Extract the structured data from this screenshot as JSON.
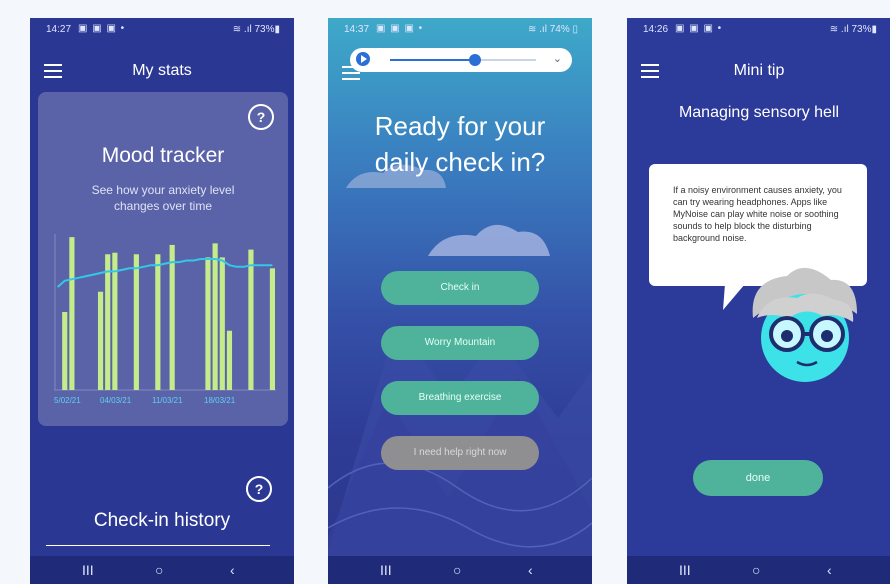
{
  "panel1": {
    "status": {
      "time": "14:27",
      "icons": "▣ ▣ ▣ •",
      "battery": "≋ .ıl 73%▮"
    },
    "title": "My stats",
    "mood": {
      "title": "Mood tracker",
      "subtitle": "See how your anxiety level changes over time",
      "help": "?"
    },
    "history": {
      "title": "Check-in history",
      "help": "?"
    }
  },
  "panel2": {
    "status": {
      "time": "14:37",
      "icons": "▣ ▣ ▣ •",
      "battery": "≋ .ıl 74% ▯"
    },
    "media": {
      "progress": 0.58
    },
    "title_line1": "Ready for your",
    "title_line2": "daily check in?",
    "buttons": {
      "check_in": "Check in",
      "worry": "Worry Mountain",
      "breathing": "Breathing exercise",
      "help": "I need help right now"
    }
  },
  "panel3": {
    "status": {
      "time": "14:26",
      "icons": "▣ ▣ ▣ •",
      "battery": "≋ .ıl 73%▮"
    },
    "title": "Mini tip",
    "subtitle": "Managing sensory hell",
    "tip": "If a noisy environment causes anxiety, you can try wearing headphones. Apps like MyNoise can play white noise or soothing sounds to help block the disturbing background noise.",
    "done": "done"
  },
  "nav": {
    "recent": "III",
    "home": "○",
    "back": "‹"
  },
  "colors": {
    "panel_bg": "#2b3893",
    "pill": "#4fb39b",
    "bar": "#c5ec8b",
    "line": "#33c8e8"
  },
  "chart_data": {
    "type": "bar",
    "x_tick_labels": [
      "5/02/21",
      "04/03/21",
      "11/03/21",
      "18/03/21"
    ],
    "bars": [
      0,
      0.5,
      0.98,
      0,
      0,
      0,
      0.63,
      0.87,
      0.88,
      0,
      0,
      0.87,
      0,
      0,
      0.87,
      0,
      0.93,
      0,
      0,
      0,
      0,
      0.85,
      0.94,
      0.85,
      0.38,
      0,
      0,
      0.9,
      0,
      0,
      0.78
    ],
    "line": [
      0.66,
      0.7,
      0.71,
      0.72,
      0.73,
      0.74,
      0.75,
      0.76,
      0.76,
      0.77,
      0.78,
      0.78,
      0.79,
      0.8,
      0.8,
      0.81,
      0.82,
      0.82,
      0.83,
      0.83,
      0.84,
      0.84,
      0.84,
      0.83,
      0.8,
      0.79,
      0.79,
      0.8,
      0.8,
      0.8,
      0.8
    ]
  }
}
